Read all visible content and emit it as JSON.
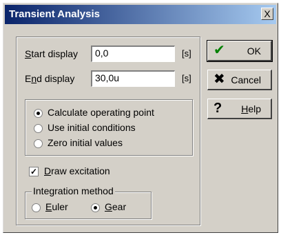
{
  "window": {
    "title": "Transient Analysis",
    "close_label": "X"
  },
  "start_display": {
    "label_underlined": "S",
    "label_rest": "tart display",
    "value": "0,0",
    "unit": "[s]"
  },
  "end_display": {
    "label_pre": "E",
    "label_underlined": "n",
    "label_rest": "d display",
    "value": "30,0u",
    "unit": "[s]"
  },
  "initial_mode": {
    "options": [
      {
        "label": "Calculate operating point",
        "selected": true
      },
      {
        "label": "Use initial conditions",
        "selected": false
      },
      {
        "label": "Zero initial values",
        "selected": false
      }
    ]
  },
  "draw_excitation": {
    "label_underlined": "D",
    "label_rest": "raw excitation",
    "checked": true,
    "check_mark": "✓"
  },
  "integration": {
    "legend": "Integration method",
    "euler": {
      "label_underlined": "E",
      "label_rest": "uler",
      "selected": false
    },
    "gear": {
      "label_underlined": "G",
      "label_rest": "ear",
      "selected": true
    }
  },
  "buttons": {
    "ok": {
      "label": "OK",
      "icon": "check-icon",
      "icon_glyph": "✔",
      "icon_color": "#008000"
    },
    "cancel": {
      "label": "Cancel",
      "icon": "cross-icon",
      "icon_glyph": "✖",
      "icon_color": "#000000"
    },
    "help": {
      "label_underlined": "H",
      "label_rest": "elp",
      "icon": "question-icon",
      "icon_glyph": "?",
      "icon_color": "#000000"
    }
  }
}
